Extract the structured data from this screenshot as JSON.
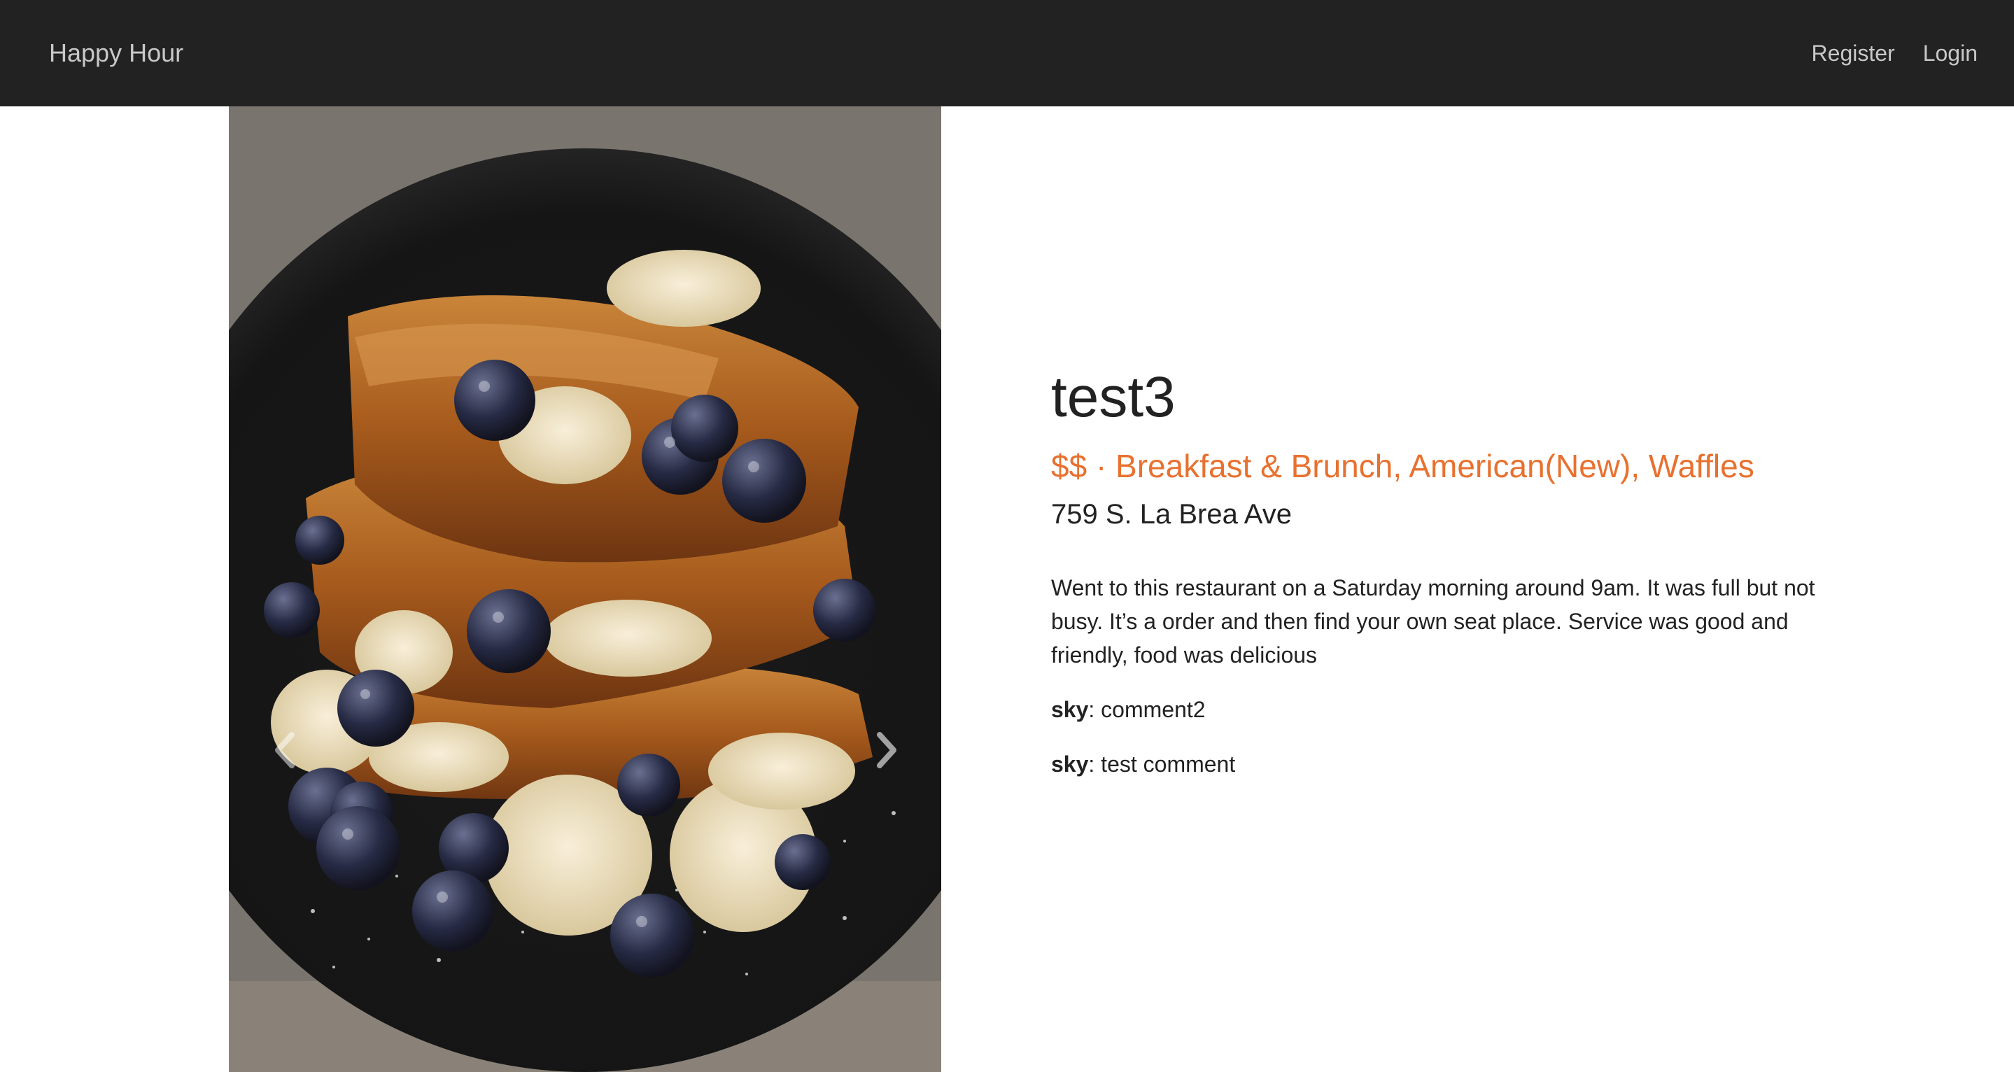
{
  "navbar": {
    "brand": "Happy Hour",
    "links": [
      {
        "label": "Register"
      },
      {
        "label": "Login"
      }
    ]
  },
  "carousel": {
    "prev_icon": "chevron-left-icon",
    "next_icon": "chevron-right-icon"
  },
  "restaurant": {
    "name": "test3",
    "meta": "$$ · Breakfast & Brunch, American(New), Waffles",
    "address": "759 S. La Brea Ave",
    "review": "Went to this restaurant on a Saturday morning around 9am. It was full but not busy. It’s a order and then find your own seat place. Service was good and friendly, food was delicious"
  },
  "comments": [
    {
      "user": "sky",
      "text": ": comment2"
    },
    {
      "user": "sky",
      "text": ": test comment"
    }
  ],
  "colors": {
    "navbar_bg": "#222222",
    "accent": "#e8712f"
  }
}
